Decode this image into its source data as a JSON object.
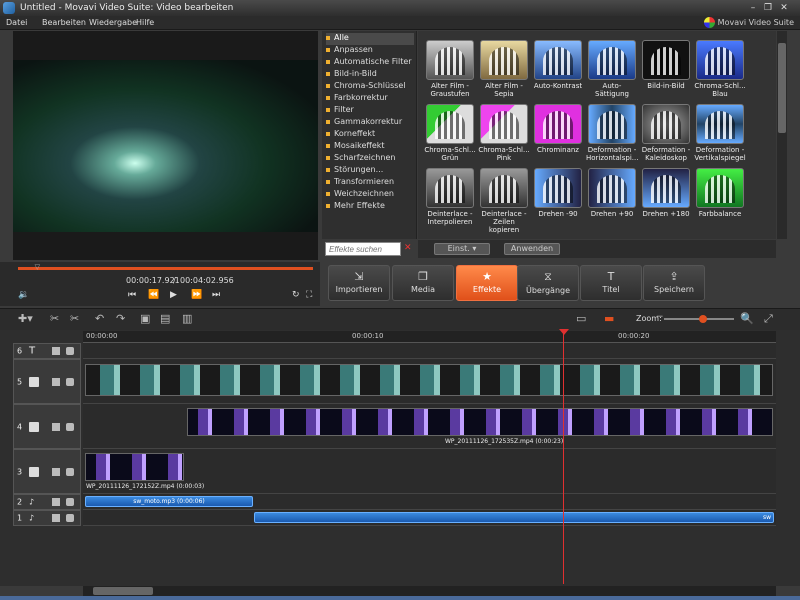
{
  "window": {
    "title": "Untitled - Movavi Video Suite: Video bearbeiten",
    "controls": [
      "–",
      "❐",
      "✕"
    ]
  },
  "menu": [
    "Datei",
    "Bearbeiten",
    "Wiedergabe",
    "Hilfe"
  ],
  "brand": "Movavi Video Suite",
  "categories": [
    "Alle",
    "Anpassen",
    "Automatische Filter",
    "Bild-in-Bild",
    "Chroma-Schlüssel",
    "Farbkorrektur",
    "Filter",
    "Gammakorrektur",
    "Korneffekt",
    "Mosaikeffekt",
    "Scharfzeichnen",
    "Störungen...",
    "Transformieren",
    "Weichzeichnen",
    "Mehr Effekte"
  ],
  "search": {
    "placeholder": "Effekte suchen"
  },
  "effects": [
    {
      "label": "Alter Film -\nGraustufen"
    },
    {
      "label": "Alter Film -\nSepia"
    },
    {
      "label": "Auto-Kontrast"
    },
    {
      "label": "Auto-Sättigung"
    },
    {
      "label": "Bild-in-Bild"
    },
    {
      "label": "Chroma-Schl...\nBlau"
    },
    {
      "label": "Chroma-Schl...\nGrün"
    },
    {
      "label": "Chroma-Schl...\nPink"
    },
    {
      "label": "Chrominanz"
    },
    {
      "label": "Deformation -\nHorizontalspi..."
    },
    {
      "label": "Deformation -\nKaleidoskop"
    },
    {
      "label": "Deformation -\nVertikalspiegel"
    },
    {
      "label": "Deinterlace -\nInterpolieren"
    },
    {
      "label": "Deinterlace -\nZeilen kopieren"
    },
    {
      "label": "Drehen -90"
    },
    {
      "label": "Drehen +90"
    },
    {
      "label": "Drehen +180"
    },
    {
      "label": "Farbbalance"
    }
  ],
  "fxbar": {
    "settings": "Einst.",
    "apply": "Anwenden"
  },
  "player": {
    "current": "00:00:17.921",
    "total": "00:04:02.956",
    "progress": 0.07
  },
  "tabs": [
    {
      "label": "Importieren",
      "icon": "⇲"
    },
    {
      "label": "Media",
      "icon": "❐"
    },
    {
      "label": "Effekte",
      "icon": "★"
    },
    {
      "label": "Übergänge",
      "icon": "⧖"
    },
    {
      "label": "Titel",
      "icon": "T"
    },
    {
      "label": "Speichern",
      "icon": "⇪"
    }
  ],
  "zoom": {
    "label": "Zoom:",
    "level": 0.55
  },
  "ruler": [
    "00:00:00",
    "00:00:10",
    "00:00:20"
  ],
  "tracks": [
    "6",
    "5",
    "4",
    "3",
    "2",
    "1"
  ],
  "clips": {
    "track4": "WP_20111126_172535Z.mp4 (0:00:23)",
    "track3": "WP_20111126_172152Z.mp4 (0:00:03)",
    "audio2": "sw_moto.mp3 (0:00:06)",
    "audio1": "sw"
  }
}
